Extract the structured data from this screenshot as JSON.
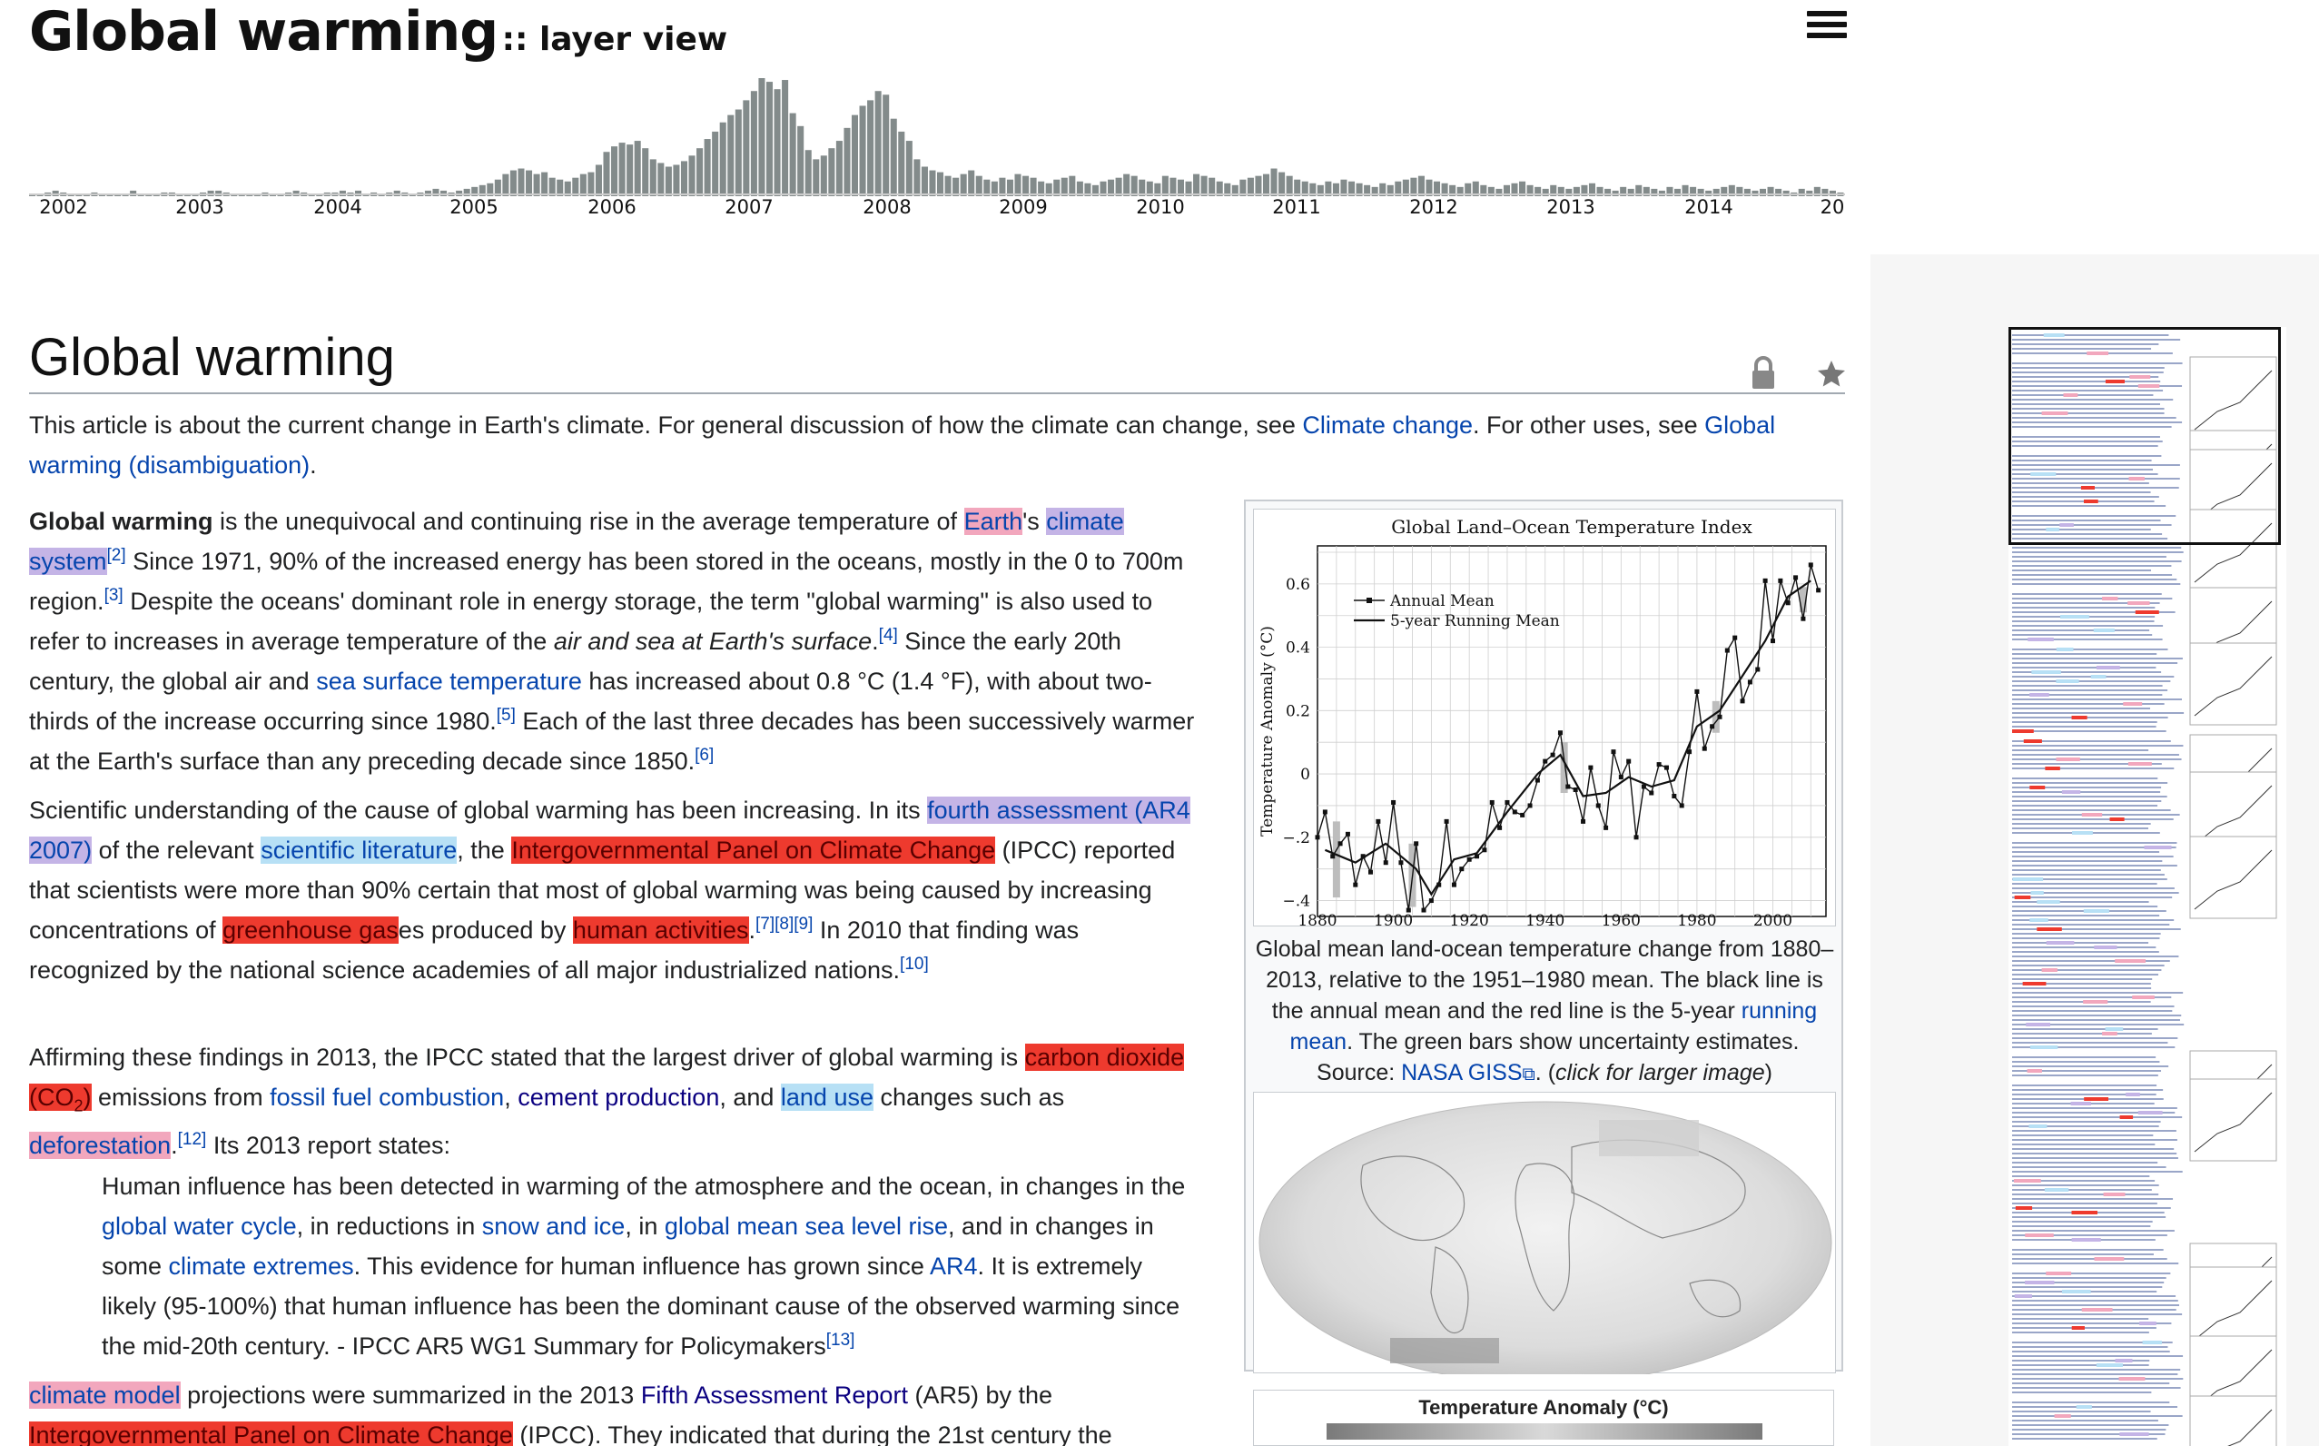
{
  "app": {
    "title": "Global warming",
    "subtitle": ":: layer view"
  },
  "timeline": {
    "years": [
      "2002",
      "2003",
      "2004",
      "2005",
      "2006",
      "2007",
      "2008",
      "2009",
      "2010",
      "2011",
      "2012",
      "2013",
      "2014",
      "20"
    ],
    "bar_color": "#838b8b",
    "activity": [
      1,
      1,
      2,
      3,
      2,
      1,
      1,
      1,
      2,
      1,
      1,
      1,
      1,
      3,
      1,
      1,
      1,
      2,
      2,
      1,
      1,
      1,
      2,
      3,
      3,
      2,
      1,
      1,
      1,
      1,
      2,
      1,
      1,
      2,
      3,
      2,
      1,
      1,
      2,
      2,
      3,
      2,
      3,
      1,
      2,
      1,
      2,
      3,
      2,
      1,
      2,
      3,
      4,
      3,
      2,
      3,
      4,
      5,
      6,
      7,
      9,
      12,
      14,
      15,
      14,
      12,
      13,
      10,
      9,
      8,
      10,
      12,
      13,
      17,
      24,
      27,
      29,
      28,
      30,
      26,
      20,
      18,
      16,
      17,
      19,
      22,
      26,
      31,
      35,
      40,
      44,
      47,
      52,
      57,
      64,
      62,
      58,
      63,
      45,
      38,
      25,
      20,
      22,
      26,
      30,
      37,
      44,
      49,
      52,
      57,
      55,
      42,
      35,
      30,
      20,
      16,
      14,
      13,
      11,
      10,
      12,
      14,
      11,
      9,
      8,
      10,
      9,
      12,
      11,
      10,
      8,
      7,
      9,
      10,
      11,
      8,
      7,
      6,
      8,
      9,
      10,
      12,
      11,
      9,
      8,
      7,
      11,
      10,
      9,
      8,
      12,
      11,
      10,
      8,
      7,
      6,
      9,
      10,
      11,
      12,
      15,
      13,
      11,
      9,
      8,
      7,
      6,
      8,
      7,
      9,
      8,
      7,
      6,
      5,
      7,
      6,
      8,
      9,
      10,
      11,
      9,
      8,
      7,
      6,
      5,
      7,
      8,
      6,
      5,
      4,
      6,
      7,
      8,
      6,
      5,
      4,
      6,
      5,
      4,
      5,
      6,
      7,
      5,
      4,
      3,
      5,
      4,
      6,
      5,
      4,
      3,
      5,
      4,
      6,
      5,
      4,
      3,
      4,
      5,
      6,
      5,
      4,
      3,
      4,
      5,
      4,
      3,
      2,
      4,
      3,
      5,
      4,
      3,
      2
    ]
  },
  "article": {
    "title": "Global warming",
    "hatnote": {
      "t1": "This article is about the current change in Earth's climate. For general discussion of how the climate can change, see ",
      "l1": "Climate change",
      "t2": ". For other uses, see ",
      "l2": "Global warming (disambiguation)",
      "t3": "."
    },
    "p1": {
      "b": "Global warming",
      "t1": " is the unequivocal and continuing rise in the average temperature of ",
      "l_earth": "Earth",
      "t2": "'s ",
      "l_climate": "climate system",
      "r2": "[2]",
      "t3": " Since 1971, 90% of the increased energy has been stored in the oceans, mostly in the 0 to 700m region.",
      "r3": "[3]",
      "t4": " Despite the oceans' dominant role in energy storage, the term \"global warming\" is also used to refer to increases in average temperature of the ",
      "i1": "air and sea at Earth's surface",
      "t5": ".",
      "r4": "[4]",
      "t6": " Since the early 20th century, the global air and ",
      "l_sst": "sea surface temperature",
      "t7": " has increased about 0.8 °C (1.4 °F), with about two-thirds of the increase occurring since 1980.",
      "r5": "[5]",
      "t8": " Each of the last three decades has been successively warmer at the Earth's surface than any preceding decade since 1850.",
      "r6": "[6]"
    },
    "p2": {
      "t1": "Scientific understanding of the cause of global warming has been increasing. In its ",
      "l_ar4": "fourth assessment (AR4 2007)",
      "t2": " of the relevant ",
      "l_sci": "scientific literature",
      "t3": ", the ",
      "l_ipcc": "Intergovernmental Panel on Climate Change",
      "t4": " (IPCC) reported that scientists were more than 90% certain that most of global warming was being caused by increasing concentrations of ",
      "l_ghg": "greenhouse gas",
      "t5": "es produced by ",
      "l_human": "human activities",
      "t6": ".",
      "r789": "[7][8][9]",
      "t7": " In 2010 that finding was recognized by the national science academies of all major industrialized nations.",
      "r10": "[10]"
    },
    "p3": {
      "t1": "Affirming these findings in 2013, the IPCC stated that the largest driver of global warming is ",
      "l_co2": "carbon dioxide (CO",
      "sub": "2",
      "l_co2_end": ")",
      "t2": " emissions from ",
      "l_fossil": "fossil fuel combustion",
      "t3": ", ",
      "l_cement": "cement production",
      "t4": ", and ",
      "l_landuse": "land use",
      "t5": " changes such as ",
      "l_defor": "deforestation",
      "t6": ".",
      "r12": "[12]",
      "t7": " Its 2013 report states:"
    },
    "quote": {
      "t1": "Human influence has been detected in warming of the atmosphere and the ocean, in changes in the ",
      "l_water": "global water cycle",
      "t2": ", in reductions in ",
      "l_snow": "snow and ice",
      "t3": ", in ",
      "l_sea": "global mean sea level rise",
      "t4": ", and in changes in some ",
      "l_extremes": "climate extremes",
      "t5": ". This evidence for human influence has grown since ",
      "l_ar4b": "AR4",
      "t6": ". It is extremely likely (95-100%) that human influence has been the dominant cause of the observed warming since the mid-20th century. - IPCC AR5 WG1 Summary for Policymakers",
      "r13": "[13]"
    },
    "p4": {
      "l_model": "climate model",
      "t1": " projections were summarized in the 2013 ",
      "l_ar5": "Fifth Assessment Report",
      "t2": " (AR5) by the ",
      "l_ipcc2": "Intergovernmental Panel on Climate Change",
      "t3": " (IPCC). They indicated that during the 21st century the"
    }
  },
  "figure1": {
    "caption_t1": "Global mean land-ocean temperature change from 1880–2013, relative to the 1951–1980 mean. The black line is the annual mean and the red line is the 5-year ",
    "caption_link": "running mean",
    "caption_t2": ". The green bars show uncertainty estimates. Source: ",
    "caption_source": "NASA GISS",
    "caption_t3": ". (",
    "caption_click": "click for larger image",
    "caption_t4": ")"
  },
  "figure2": {
    "map_label": "Temperature Anomaly (°C)"
  },
  "chart_data": {
    "type": "line",
    "title": "Global Land–Ocean Temperature Index",
    "xlabel": "",
    "ylabel": "Temperature Anomaly (°C)",
    "xlim": [
      1880,
      2014
    ],
    "ylim": [
      -0.45,
      0.72
    ],
    "x_ticks": [
      1880,
      1900,
      1920,
      1940,
      1960,
      1980,
      2000
    ],
    "y_ticks": [
      -0.4,
      -0.2,
      0,
      0.2,
      0.4,
      0.6
    ],
    "y_tick_labels": [
      "−.4",
      "−.2",
      "0",
      "0.2",
      "0.4",
      "0.6"
    ],
    "grid": true,
    "legend": "top-left",
    "series": [
      {
        "name": "Annual Mean",
        "x": [
          1880,
          1882,
          1884,
          1886,
          1888,
          1890,
          1892,
          1894,
          1896,
          1898,
          1900,
          1902,
          1904,
          1906,
          1908,
          1910,
          1912,
          1914,
          1916,
          1918,
          1920,
          1922,
          1924,
          1926,
          1928,
          1930,
          1932,
          1934,
          1936,
          1938,
          1940,
          1942,
          1944,
          1946,
          1948,
          1950,
          1952,
          1954,
          1956,
          1958,
          1960,
          1962,
          1964,
          1966,
          1968,
          1970,
          1972,
          1974,
          1976,
          1978,
          1980,
          1982,
          1984,
          1986,
          1988,
          1990,
          1992,
          1994,
          1996,
          1998,
          2000,
          2002,
          2004,
          2006,
          2008,
          2010,
          2012
        ],
        "values": [
          -0.2,
          -0.12,
          -0.26,
          -0.22,
          -0.19,
          -0.35,
          -0.26,
          -0.31,
          -0.15,
          -0.28,
          -0.09,
          -0.28,
          -0.43,
          -0.22,
          -0.43,
          -0.4,
          -0.35,
          -0.15,
          -0.35,
          -0.3,
          -0.27,
          -0.26,
          -0.24,
          -0.09,
          -0.17,
          -0.09,
          -0.12,
          -0.13,
          -0.1,
          -0.02,
          0.04,
          0.06,
          0.13,
          -0.04,
          -0.05,
          -0.15,
          0.02,
          -0.1,
          -0.17,
          0.07,
          -0.01,
          0.04,
          -0.2,
          -0.04,
          -0.06,
          0.03,
          0.02,
          -0.07,
          -0.1,
          0.07,
          0.26,
          0.08,
          0.15,
          0.18,
          0.39,
          0.43,
          0.23,
          0.29,
          0.33,
          0.61,
          0.42,
          0.61,
          0.54,
          0.62,
          0.49,
          0.66,
          0.58
        ]
      },
      {
        "name": "5-year Running Mean",
        "x": [
          1882,
          1890,
          1898,
          1906,
          1910,
          1916,
          1922,
          1930,
          1938,
          1944,
          1950,
          1956,
          1962,
          1968,
          1974,
          1980,
          1986,
          1992,
          1998,
          2004,
          2010
        ],
        "values": [
          -0.24,
          -0.28,
          -0.22,
          -0.3,
          -0.38,
          -0.27,
          -0.25,
          -0.12,
          0.0,
          0.06,
          -0.07,
          -0.06,
          -0.01,
          -0.04,
          -0.02,
          0.15,
          0.2,
          0.31,
          0.42,
          0.56,
          0.61
        ]
      }
    ]
  }
}
